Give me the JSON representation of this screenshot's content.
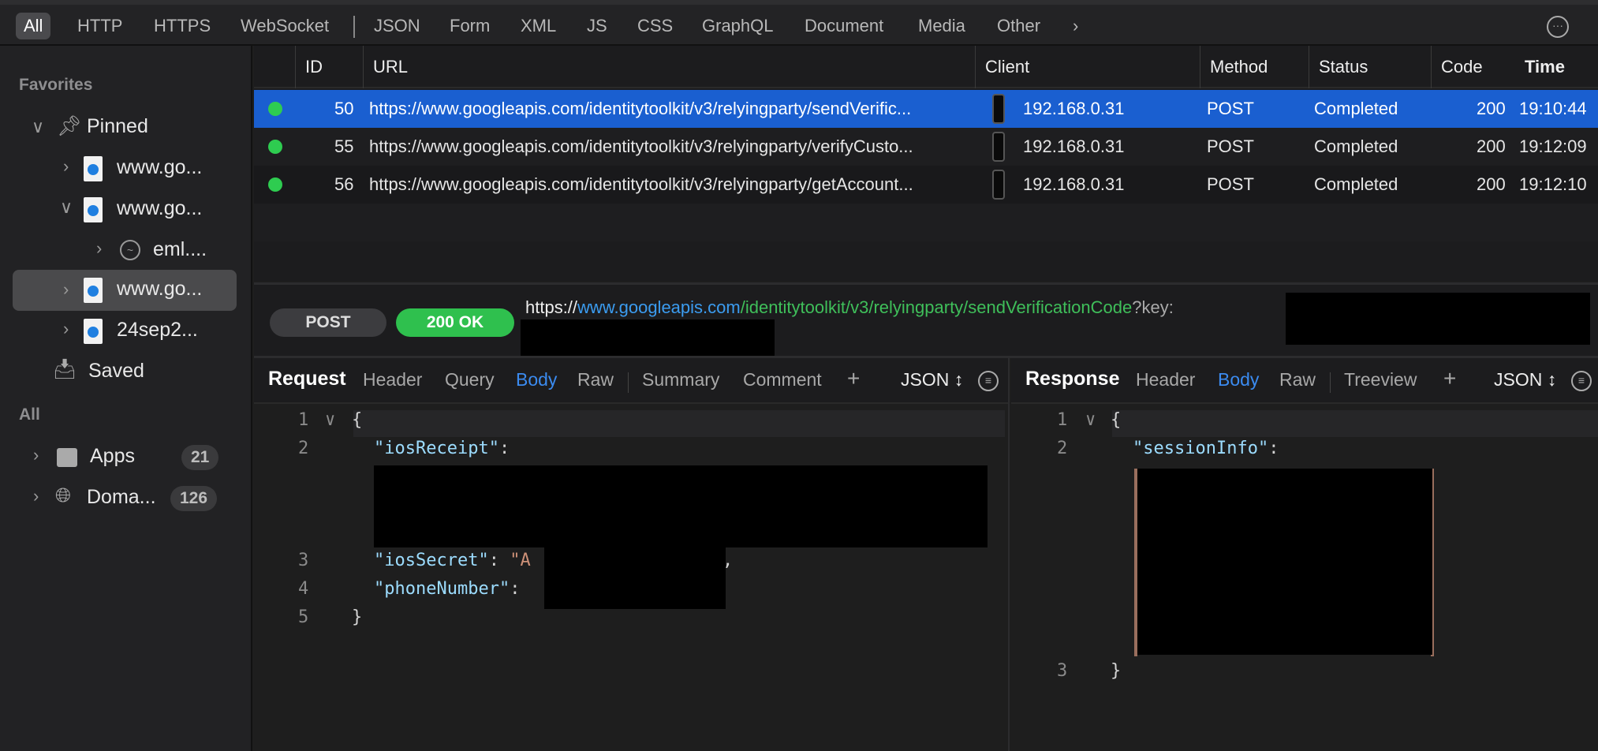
{
  "filter_tabs": [
    "All",
    "HTTP",
    "HTTPS",
    "WebSocket",
    "JSON",
    "Form",
    "XML",
    "JS",
    "CSS",
    "GraphQL",
    "Document",
    "Media",
    "Other"
  ],
  "sidebar": {
    "favorites_label": "Favorites",
    "pinned_label": "Pinned",
    "items": [
      {
        "label": "www.go..."
      },
      {
        "label": "www.go..."
      },
      {
        "label": "eml...."
      },
      {
        "label": "www.go..."
      },
      {
        "label": "24sep2..."
      }
    ],
    "saved_label": "Saved",
    "all_label": "All",
    "apps": {
      "label": "Apps",
      "count": "21"
    },
    "domains": {
      "label": "Doma...",
      "count": "126"
    }
  },
  "table": {
    "columns": [
      "ID",
      "URL",
      "Client",
      "Method",
      "Status",
      "Code",
      "Time"
    ],
    "rows": [
      {
        "id": "50",
        "url": "https://www.googleapis.com/identitytoolkit/v3/relyingparty/sendVerific...",
        "client": "192.168.0.31",
        "method": "POST",
        "status": "Completed",
        "code": "200",
        "time": "19:10:44",
        "selected": true
      },
      {
        "id": "55",
        "url": "https://www.googleapis.com/identitytoolkit/v3/relyingparty/verifyCusto...",
        "client": "192.168.0.31",
        "method": "POST",
        "status": "Completed",
        "code": "200",
        "time": "19:12:09"
      },
      {
        "id": "56",
        "url": "https://www.googleapis.com/identitytoolkit/v3/relyingparty/getAccount...",
        "client": "192.168.0.31",
        "method": "POST",
        "status": "Completed",
        "code": "200",
        "time": "19:12:10"
      }
    ]
  },
  "detail": {
    "method": "POST",
    "status": "200 OK",
    "url_scheme": "https://",
    "url_host": "www.googleapis.com",
    "url_path": "/identitytoolkit/v3/relyingparty/sendVerificationCode",
    "url_query": "?key:"
  },
  "request": {
    "title": "Request",
    "tabs": [
      "Header",
      "Query",
      "Body",
      "Raw",
      "Summary",
      "Comment"
    ],
    "active_tab": "Body",
    "format": "JSON",
    "lines": [
      {
        "n": "1",
        "text": "{"
      },
      {
        "n": "2",
        "key": "\"iosReceipt\"",
        "after": ":"
      },
      {
        "n": "3",
        "key": "\"iosSecret\"",
        "after": ": ",
        "str": "\"A",
        "tail": ","
      },
      {
        "n": "4",
        "key": "\"phoneNumber\"",
        "after": ":"
      },
      {
        "n": "5",
        "text": "}"
      }
    ]
  },
  "response": {
    "title": "Response",
    "tabs": [
      "Header",
      "Body",
      "Raw",
      "Treeview"
    ],
    "active_tab": "Body",
    "format": "JSON",
    "lines": [
      {
        "n": "1",
        "text": "{"
      },
      {
        "n": "2",
        "key": "\"sessionInfo\"",
        "after": ":"
      },
      {
        "n": "3",
        "text": "}"
      }
    ]
  },
  "colors": {
    "accent": "#1a5fd0",
    "success": "#2ecc50",
    "link_blue": "#3b9cf0",
    "link_green": "#3fbf5a"
  }
}
